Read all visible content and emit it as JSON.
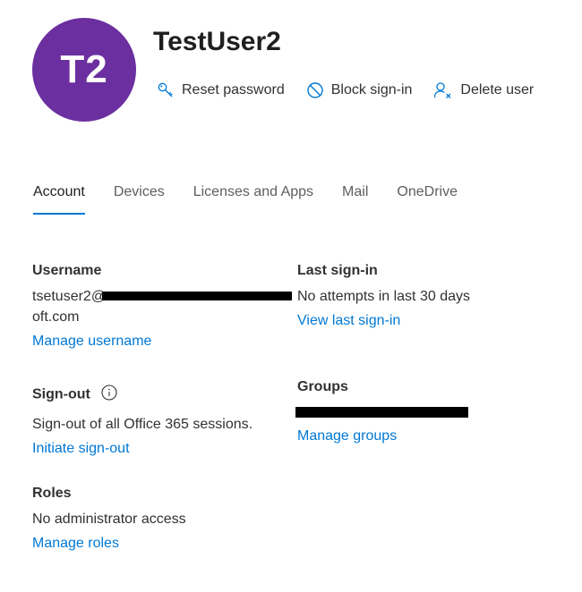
{
  "header": {
    "avatar_initials": "T2",
    "avatar_color": "#6b2fa0",
    "display_name": "TestUser2"
  },
  "actions": [
    {
      "label": "Reset password",
      "icon": "key-icon"
    },
    {
      "label": "Block sign-in",
      "icon": "block-icon"
    },
    {
      "label": "Delete user",
      "icon": "delete-user-icon"
    }
  ],
  "tabs": [
    {
      "label": "Account",
      "active": true
    },
    {
      "label": "Devices",
      "active": false
    },
    {
      "label": "Licenses and Apps",
      "active": false
    },
    {
      "label": "Mail",
      "active": false
    },
    {
      "label": "OneDrive",
      "active": false
    }
  ],
  "account": {
    "username": {
      "label": "Username",
      "value_line1": "tsetuser2@",
      "value_line2": "oft.com",
      "link": "Manage username"
    },
    "last_signin": {
      "label": "Last sign-in",
      "value": "No attempts in last 30 days",
      "link": "View last sign-in"
    },
    "signout": {
      "label": "Sign-out",
      "value": "Sign-out of all Office 365 sessions.",
      "link": "Initiate sign-out"
    },
    "groups": {
      "label": "Groups",
      "link": "Manage groups"
    },
    "roles": {
      "label": "Roles",
      "value": "No administrator access",
      "link": "Manage roles"
    }
  },
  "colors": {
    "link": "#0078d4",
    "accent_underline": "#0078d4",
    "text": "#323130"
  }
}
